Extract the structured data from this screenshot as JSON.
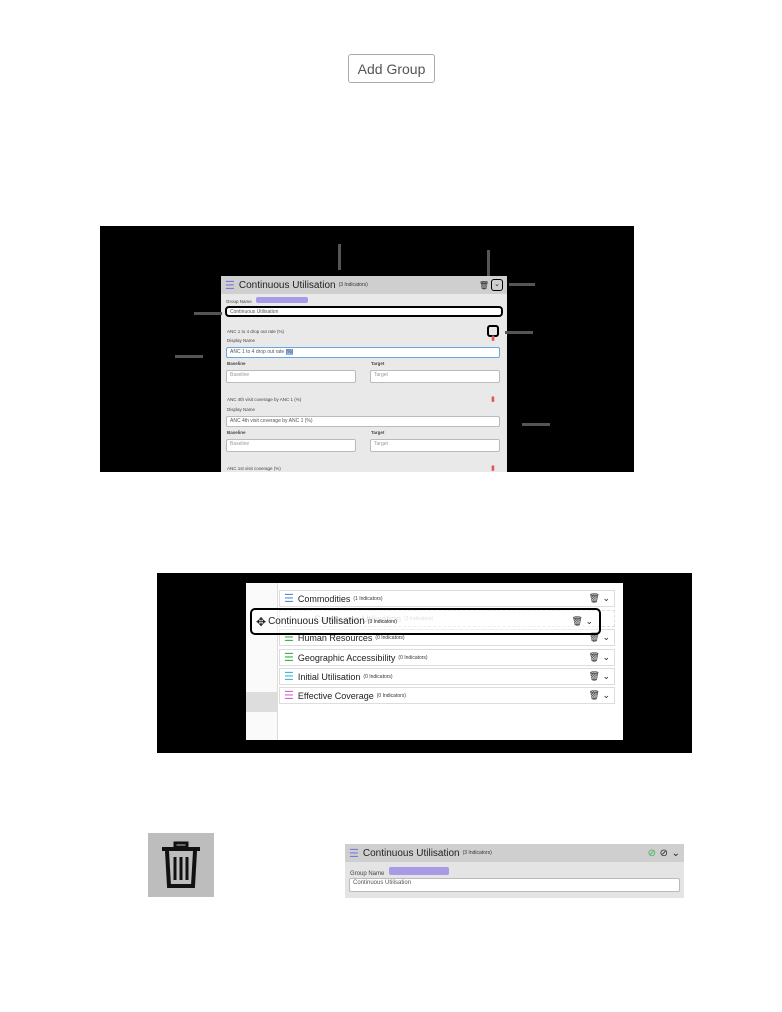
{
  "add_group_label": "Add Group",
  "fig1": {
    "group_title": "Continuous Utilisation",
    "group_count": "(3 Indicators)",
    "group_name_label": "Group Name",
    "group_name_value": "Continuous Utilisation",
    "indicators": [
      {
        "name": "ANC 1 to 4 drop out rate (%)",
        "display_label": "Display Name",
        "display_value": "ANC 1 to 4 drop out rate",
        "display_highlight": "(%)",
        "baseline_label": "Baseline",
        "target_label": "Target",
        "baseline_placeholder": "Baseline",
        "target_placeholder": "Target"
      },
      {
        "name": "ANC 4th visit coverage by ANC 1 (%)",
        "display_label": "Display Name",
        "display_value": "ANC 4th visit coverage by ANC 1 (%)",
        "baseline_label": "Baseline",
        "target_label": "Target",
        "baseline_placeholder": "Baseline",
        "target_placeholder": "Target"
      },
      {
        "name": "ANC 1st visit coverage (%)"
      }
    ]
  },
  "fig2": {
    "rows": [
      {
        "title": "Commodities",
        "count": "(1 Indicators)",
        "color": "#5b8bd8"
      },
      {
        "title": "Continuous Utilisation",
        "count": "(3 Indicators)",
        "color": "#5b8bd8"
      },
      {
        "title": "Human Resources",
        "count": "(0 Indicators)",
        "color": "#3bb34a"
      },
      {
        "title": "Geographic Accessibility",
        "count": "(0 Indicators)",
        "color": "#3bb34a"
      },
      {
        "title": "Initial Utilisation",
        "count": "(0 Indicators)",
        "color": "#40b8d8"
      },
      {
        "title": "Effective Coverage",
        "count": "(0 Indicators)",
        "color": "#d06ad0"
      }
    ],
    "dragging_title": "Continuous Utilisation",
    "dragging_count": "(3 Indicators)"
  },
  "fig3": {
    "group_title": "Continuous Utilisation",
    "group_count": "(3 Indicators)",
    "group_name_label": "Group Name",
    "group_name_value": "Continuous Utilisation"
  },
  "colors": {
    "accent_purple": "#a99ae6",
    "trash_red": "#e05555",
    "confirm_green": "#3bb34a"
  }
}
